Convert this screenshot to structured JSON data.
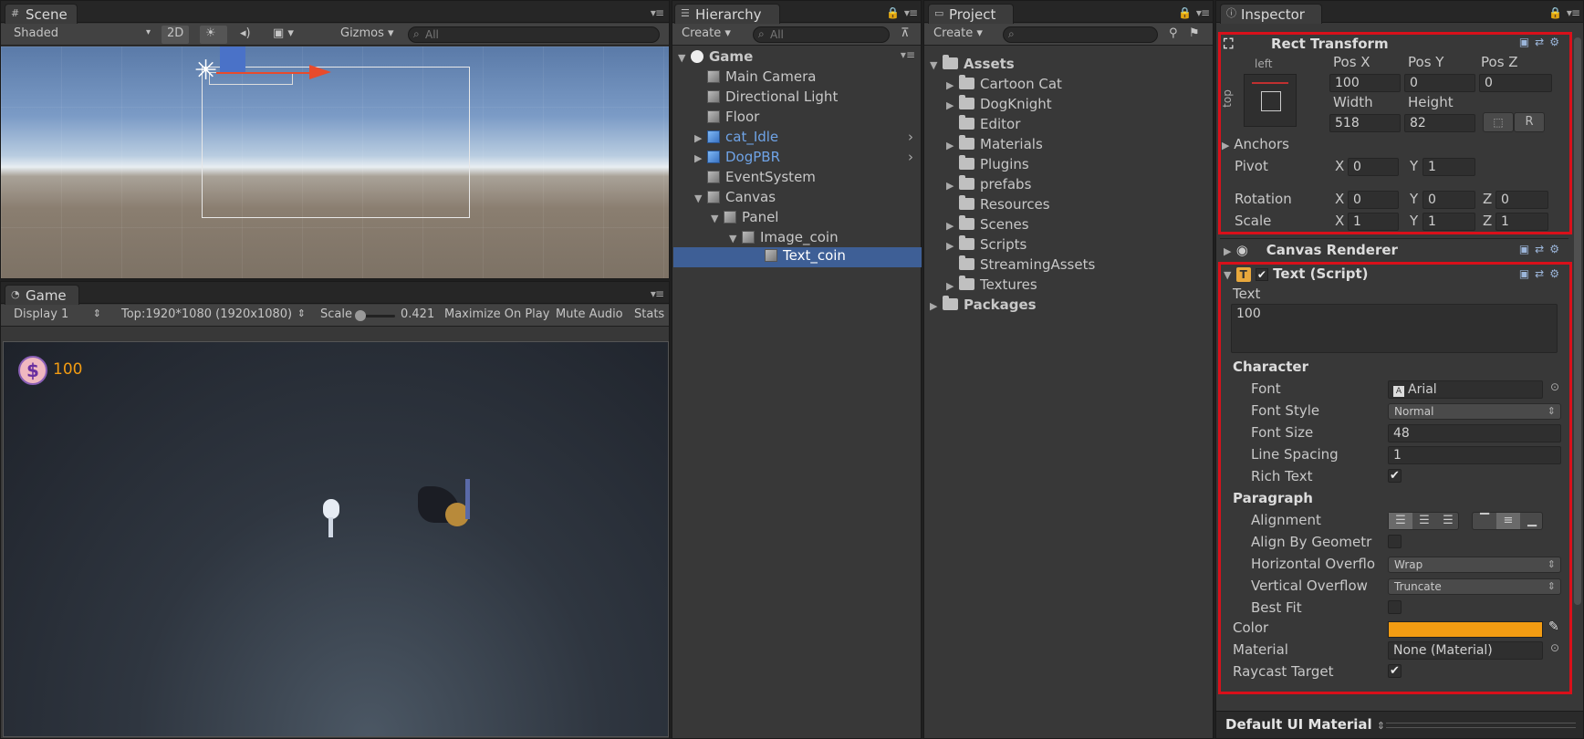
{
  "scene": {
    "tab": "Scene",
    "shading": "Shaded",
    "mode_2d": "2D",
    "gizmos": "Gizmos",
    "search_placeholder": "All"
  },
  "game": {
    "tab": "Game",
    "display": "Display 1",
    "resolution": "Top:1920*1080 (1920x1080)",
    "scale_label": "Scale",
    "scale_value": "0.421",
    "maximize": "Maximize On Play",
    "mute": "Mute Audio",
    "stats": "Stats",
    "coin_text": "100",
    "coin_symbol": "$"
  },
  "hierarchy": {
    "tab": "Hierarchy",
    "create": "Create",
    "search_placeholder": "All",
    "scene_name": "Game",
    "items": [
      {
        "label": "Main Camera"
      },
      {
        "label": "Directional Light"
      },
      {
        "label": "Floor"
      },
      {
        "label": "cat_Idle"
      },
      {
        "label": "DogPBR"
      },
      {
        "label": "EventSystem"
      },
      {
        "label": "Canvas"
      },
      {
        "label": "Panel"
      },
      {
        "label": "Image_coin"
      },
      {
        "label": "Text_coin"
      }
    ]
  },
  "project": {
    "tab": "Project",
    "create": "Create",
    "items": [
      {
        "label": "Assets"
      },
      {
        "label": "Cartoon Cat"
      },
      {
        "label": "DogKnight"
      },
      {
        "label": "Editor"
      },
      {
        "label": "Materials"
      },
      {
        "label": "Plugins"
      },
      {
        "label": "prefabs"
      },
      {
        "label": "Resources"
      },
      {
        "label": "Scenes"
      },
      {
        "label": "Scripts"
      },
      {
        "label": "StreamingAssets"
      },
      {
        "label": "Textures"
      },
      {
        "label": "Packages"
      }
    ]
  },
  "inspector": {
    "tab": "Inspector",
    "rect": {
      "title": "Rect Transform",
      "left": "left",
      "top": "top",
      "posx_label": "Pos X",
      "posy_label": "Pos Y",
      "posz_label": "Pos Z",
      "posx": "100",
      "posy": "0",
      "posz": "0",
      "width_label": "Width",
      "height_label": "Height",
      "width": "518",
      "height": "82",
      "r_button": "R",
      "anchors": "Anchors",
      "pivot": "Pivot",
      "pivot_x": "0",
      "pivot_y": "1",
      "rotation": "Rotation",
      "rot_x": "0",
      "rot_y": "0",
      "rot_z": "0",
      "scale": "Scale",
      "scale_x": "1",
      "scale_y": "1",
      "scale_z": "1",
      "x": "X",
      "y": "Y",
      "z": "Z"
    },
    "canvas_renderer": "Canvas Renderer",
    "text": {
      "title": "Text (Script)",
      "text_label": "Text",
      "text_value": "100",
      "character": "Character",
      "font_label": "Font",
      "font": "Arial",
      "font_style_label": "Font Style",
      "font_style": "Normal",
      "font_size_label": "Font Size",
      "font_size": "48",
      "line_spacing_label": "Line Spacing",
      "line_spacing": "1",
      "rich_text_label": "Rich Text",
      "paragraph": "Paragraph",
      "alignment_label": "Alignment",
      "align_geom_label": "Align By Geometr",
      "h_overflow_label": "Horizontal Overflo",
      "h_overflow": "Wrap",
      "v_overflow_label": "Vertical Overflow",
      "v_overflow": "Truncate",
      "best_fit_label": "Best Fit",
      "color_label": "Color",
      "material_label": "Material",
      "material": "None (Material)",
      "raycast_label": "Raycast Target",
      "color": "#f39c12"
    },
    "default_material": "Default UI Material"
  }
}
